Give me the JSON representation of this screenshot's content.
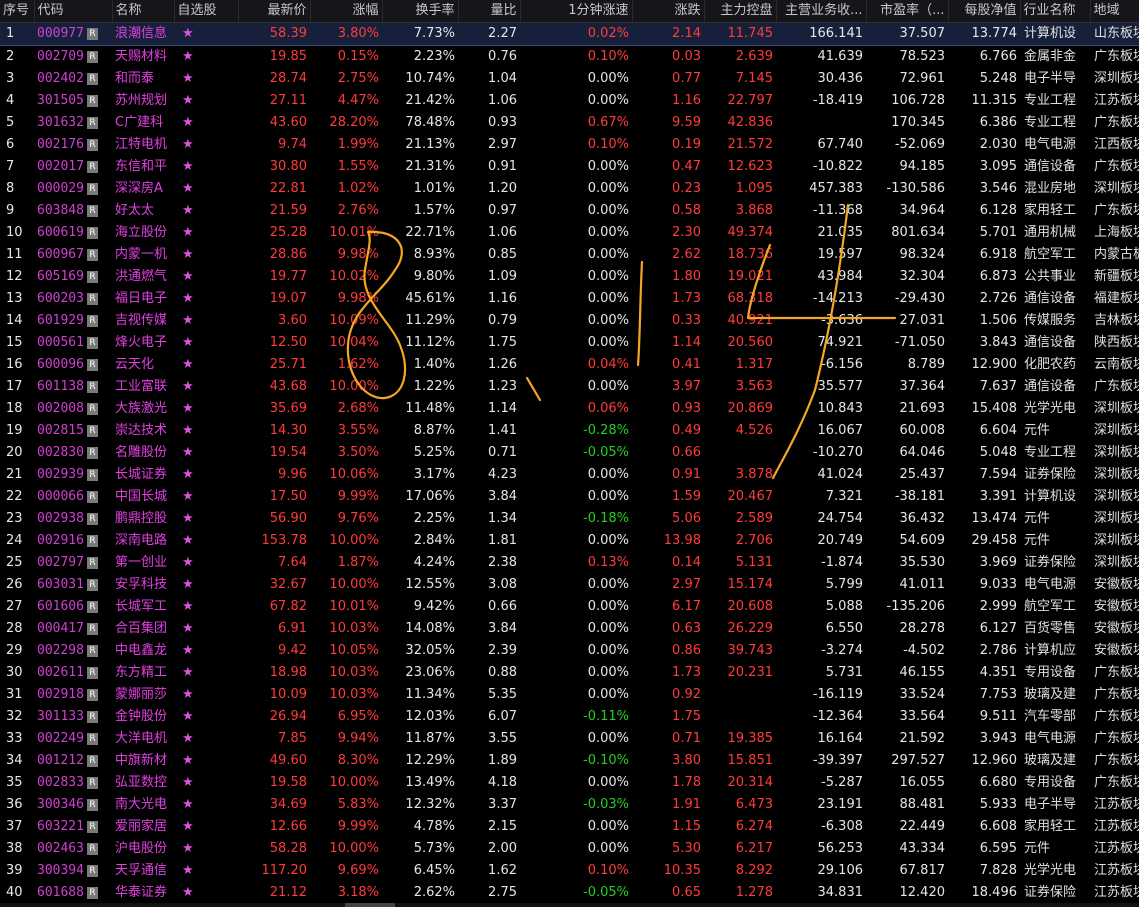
{
  "columns": {
    "seq": "序号",
    "code": "代码",
    "name": "名称",
    "fav": "自选股",
    "price": "最新价",
    "pct": "涨幅",
    "turnover": "换手率",
    "volratio": "量比",
    "speed": "1分钟涨速",
    "change": "涨跌",
    "mainctrl": "主力控盘",
    "bizgrowth": "主营业务收...",
    "pe": "市盈率（...",
    "navps": "每股净值",
    "industry": "行业名称",
    "region": "地域"
  },
  "r_badge": "R",
  "star_glyph": "★",
  "colors": {
    "up": "#ff3b3b",
    "down": "#22d022",
    "code": "#d040d0",
    "name": "#e040e0",
    "annotation": "#f5a623"
  },
  "rows": [
    {
      "seq": "1",
      "code": "000977",
      "name": "浪潮信息",
      "price": "58.39",
      "pct": "3.80%",
      "turnover": "7.73%",
      "volratio": "2.27",
      "speed": "0.02%",
      "change": "2.14",
      "mainctrl": "11.745",
      "biz": "166.141",
      "pe": "37.507",
      "navps": "13.774",
      "industry": "计算机设",
      "region": "山东板块",
      "speed_dir": "up",
      "biz_w": true
    },
    {
      "seq": "2",
      "code": "002709",
      "name": "天赐材料",
      "price": "19.85",
      "pct": "0.15%",
      "turnover": "2.23%",
      "volratio": "0.76",
      "speed": "0.10%",
      "change": "0.03",
      "mainctrl": "2.639",
      "biz": "41.639",
      "pe": "78.523",
      "navps": "6.766",
      "industry": "金属非金",
      "region": "广东板块",
      "speed_dir": "up"
    },
    {
      "seq": "3",
      "code": "002402",
      "name": "和而泰",
      "price": "28.74",
      "pct": "2.75%",
      "turnover": "10.74%",
      "volratio": "1.04",
      "speed": "0.00%",
      "change": "0.77",
      "mainctrl": "7.145",
      "biz": "30.436",
      "pe": "72.961",
      "navps": "5.248",
      "industry": "电子半导",
      "region": "深圳板块",
      "speed_dir": "flat"
    },
    {
      "seq": "4",
      "code": "301505",
      "name": "苏州规划",
      "price": "27.11",
      "pct": "4.47%",
      "turnover": "21.42%",
      "volratio": "1.06",
      "speed": "0.00%",
      "change": "1.16",
      "mainctrl": "22.797",
      "biz": "-18.419",
      "pe": "106.728",
      "navps": "11.315",
      "industry": "专业工程",
      "region": "江苏板块",
      "speed_dir": "flat"
    },
    {
      "seq": "5",
      "code": "301632",
      "name": "C广建科",
      "price": "43.60",
      "pct": "28.20%",
      "turnover": "78.48%",
      "volratio": "0.93",
      "speed": "0.67%",
      "change": "9.59",
      "mainctrl": "42.836",
      "biz": "",
      "pe": "170.345",
      "navps": "6.386",
      "industry": "专业工程",
      "region": "广东板块",
      "speed_dir": "up"
    },
    {
      "seq": "6",
      "code": "002176",
      "name": "江特电机",
      "price": "9.74",
      "pct": "1.99%",
      "turnover": "21.13%",
      "volratio": "2.97",
      "speed": "0.10%",
      "change": "0.19",
      "mainctrl": "21.572",
      "biz": "67.740",
      "pe": "-52.069",
      "navps": "2.030",
      "industry": "电气电源",
      "region": "江西板块",
      "speed_dir": "up"
    },
    {
      "seq": "7",
      "code": "002017",
      "name": "东信和平",
      "price": "30.80",
      "pct": "1.55%",
      "turnover": "21.31%",
      "volratio": "0.91",
      "speed": "0.00%",
      "change": "0.47",
      "mainctrl": "12.623",
      "biz": "-10.822",
      "pe": "94.185",
      "navps": "3.095",
      "industry": "通信设备",
      "region": "广东板块",
      "speed_dir": "flat"
    },
    {
      "seq": "8",
      "code": "000029",
      "name": "深深房A",
      "price": "22.81",
      "pct": "1.02%",
      "turnover": "1.01%",
      "volratio": "1.20",
      "speed": "0.00%",
      "change": "0.23",
      "mainctrl": "1.095",
      "biz": "457.383",
      "pe": "-130.586",
      "navps": "3.546",
      "industry": "混业房地",
      "region": "深圳板块",
      "speed_dir": "flat"
    },
    {
      "seq": "9",
      "code": "603848",
      "name": "好太太",
      "price": "21.59",
      "pct": "2.76%",
      "turnover": "1.57%",
      "volratio": "0.97",
      "speed": "0.00%",
      "change": "0.58",
      "mainctrl": "3.868",
      "biz": "-11.368",
      "pe": "34.964",
      "navps": "6.128",
      "industry": "家用轻工",
      "region": "广东板块",
      "speed_dir": "flat"
    },
    {
      "seq": "10",
      "code": "600619",
      "name": "海立股份",
      "price": "25.28",
      "pct": "10.01%",
      "turnover": "22.71%",
      "volratio": "1.06",
      "speed": "0.00%",
      "change": "2.30",
      "mainctrl": "49.374",
      "biz": "21.035",
      "pe": "801.634",
      "navps": "5.701",
      "industry": "通用机械",
      "region": "上海板块",
      "speed_dir": "flat"
    },
    {
      "seq": "11",
      "code": "600967",
      "name": "内蒙一机",
      "price": "28.86",
      "pct": "9.98%",
      "turnover": "8.93%",
      "volratio": "0.85",
      "speed": "0.00%",
      "change": "2.62",
      "mainctrl": "18.736",
      "biz": "19.597",
      "pe": "98.324",
      "navps": "6.918",
      "industry": "航空军工",
      "region": "内蒙古板",
      "speed_dir": "flat"
    },
    {
      "seq": "12",
      "code": "605169",
      "name": "洪通燃气",
      "price": "19.77",
      "pct": "10.02%",
      "turnover": "9.80%",
      "volratio": "1.09",
      "speed": "0.00%",
      "change": "1.80",
      "mainctrl": "19.021",
      "biz": "43.984",
      "pe": "32.304",
      "navps": "6.873",
      "industry": "公共事业",
      "region": "新疆板块",
      "speed_dir": "flat"
    },
    {
      "seq": "13",
      "code": "600203",
      "name": "福日电子",
      "price": "19.07",
      "pct": "9.98%",
      "turnover": "45.61%",
      "volratio": "1.16",
      "speed": "0.00%",
      "change": "1.73",
      "mainctrl": "68.318",
      "biz": "-14.213",
      "pe": "-29.430",
      "navps": "2.726",
      "industry": "通信设备",
      "region": "福建板块",
      "speed_dir": "flat"
    },
    {
      "seq": "14",
      "code": "601929",
      "name": "吉视传媒",
      "price": "3.60",
      "pct": "10.09%",
      "turnover": "11.29%",
      "volratio": "0.79",
      "speed": "0.00%",
      "change": "0.33",
      "mainctrl": "40.921",
      "biz": "-3.636",
      "pe": "27.031",
      "navps": "1.506",
      "industry": "传媒服务",
      "region": "吉林板块",
      "speed_dir": "flat"
    },
    {
      "seq": "15",
      "code": "000561",
      "name": "烽火电子",
      "price": "12.50",
      "pct": "10.04%",
      "turnover": "11.12%",
      "volratio": "1.75",
      "speed": "0.00%",
      "change": "1.14",
      "mainctrl": "20.560",
      "biz": "74.921",
      "pe": "-71.050",
      "navps": "3.843",
      "industry": "通信设备",
      "region": "陕西板块",
      "speed_dir": "flat"
    },
    {
      "seq": "16",
      "code": "600096",
      "name": "云天化",
      "price": "25.71",
      "pct": "1.62%",
      "turnover": "1.40%",
      "volratio": "1.26",
      "speed": "0.04%",
      "change": "0.41",
      "mainctrl": "1.317",
      "biz": "-6.156",
      "pe": "8.789",
      "navps": "12.900",
      "industry": "化肥农药",
      "region": "云南板块",
      "speed_dir": "up"
    },
    {
      "seq": "17",
      "code": "601138",
      "name": "工业富联",
      "price": "43.68",
      "pct": "10.00%",
      "turnover": "1.22%",
      "volratio": "1.23",
      "speed": "0.00%",
      "change": "3.97",
      "mainctrl": "3.563",
      "biz": "35.577",
      "pe": "37.364",
      "navps": "7.637",
      "industry": "通信设备",
      "region": "广东板块",
      "speed_dir": "flat"
    },
    {
      "seq": "18",
      "code": "002008",
      "name": "大族激光",
      "price": "35.69",
      "pct": "2.68%",
      "turnover": "11.48%",
      "volratio": "1.14",
      "speed": "0.06%",
      "change": "0.93",
      "mainctrl": "20.869",
      "biz": "10.843",
      "pe": "21.693",
      "navps": "15.408",
      "industry": "光学光电",
      "region": "深圳板块",
      "speed_dir": "up"
    },
    {
      "seq": "19",
      "code": "002815",
      "name": "崇达技术",
      "price": "14.30",
      "pct": "3.55%",
      "turnover": "8.87%",
      "volratio": "1.41",
      "speed": "-0.28%",
      "change": "0.49",
      "mainctrl": "4.526",
      "biz": "16.067",
      "pe": "60.008",
      "navps": "6.604",
      "industry": "元件",
      "region": "深圳板块",
      "speed_dir": "down"
    },
    {
      "seq": "20",
      "code": "002830",
      "name": "名雕股份",
      "price": "19.54",
      "pct": "3.50%",
      "turnover": "5.25%",
      "volratio": "0.71",
      "speed": "-0.05%",
      "change": "0.66",
      "mainctrl": "",
      "biz": "-10.270",
      "pe": "64.046",
      "navps": "5.048",
      "industry": "专业工程",
      "region": "深圳板块",
      "speed_dir": "down"
    },
    {
      "seq": "21",
      "code": "002939",
      "name": "长城证券",
      "price": "9.96",
      "pct": "10.06%",
      "turnover": "3.17%",
      "volratio": "4.23",
      "speed": "0.00%",
      "change": "0.91",
      "mainctrl": "3.878",
      "biz": "41.024",
      "pe": "25.437",
      "navps": "7.594",
      "industry": "证券保险",
      "region": "深圳板块",
      "speed_dir": "flat"
    },
    {
      "seq": "22",
      "code": "000066",
      "name": "中国长城",
      "price": "17.50",
      "pct": "9.99%",
      "turnover": "17.06%",
      "volratio": "3.84",
      "speed": "0.00%",
      "change": "1.59",
      "mainctrl": "20.467",
      "biz": "7.321",
      "pe": "-38.181",
      "navps": "3.391",
      "industry": "计算机设",
      "region": "深圳板块",
      "speed_dir": "flat"
    },
    {
      "seq": "23",
      "code": "002938",
      "name": "鹏鼎控股",
      "price": "56.90",
      "pct": "9.76%",
      "turnover": "2.25%",
      "volratio": "1.34",
      "speed": "-0.18%",
      "change": "5.06",
      "mainctrl": "2.589",
      "biz": "24.754",
      "pe": "36.432",
      "navps": "13.474",
      "industry": "元件",
      "region": "深圳板块",
      "speed_dir": "down"
    },
    {
      "seq": "24",
      "code": "002916",
      "name": "深南电路",
      "price": "153.78",
      "pct": "10.00%",
      "turnover": "2.84%",
      "volratio": "1.81",
      "speed": "0.00%",
      "change": "13.98",
      "mainctrl": "2.706",
      "biz": "20.749",
      "pe": "54.609",
      "navps": "29.458",
      "industry": "元件",
      "region": "深圳板块",
      "speed_dir": "flat"
    },
    {
      "seq": "25",
      "code": "002797",
      "name": "第一创业",
      "price": "7.64",
      "pct": "1.87%",
      "turnover": "4.24%",
      "volratio": "2.38",
      "speed": "0.13%",
      "change": "0.14",
      "mainctrl": "5.131",
      "biz": "-1.874",
      "pe": "35.530",
      "navps": "3.969",
      "industry": "证券保险",
      "region": "深圳板块",
      "speed_dir": "up"
    },
    {
      "seq": "26",
      "code": "603031",
      "name": "安孚科技",
      "price": "32.67",
      "pct": "10.00%",
      "turnover": "12.55%",
      "volratio": "3.08",
      "speed": "0.00%",
      "change": "2.97",
      "mainctrl": "15.174",
      "biz": "5.799",
      "pe": "41.011",
      "navps": "9.033",
      "industry": "电气电源",
      "region": "安徽板块",
      "speed_dir": "flat"
    },
    {
      "seq": "27",
      "code": "601606",
      "name": "长城军工",
      "price": "67.82",
      "pct": "10.01%",
      "turnover": "9.42%",
      "volratio": "0.66",
      "speed": "0.00%",
      "change": "6.17",
      "mainctrl": "20.608",
      "biz": "5.088",
      "pe": "-135.206",
      "navps": "2.999",
      "industry": "航空军工",
      "region": "安徽板块",
      "speed_dir": "flat"
    },
    {
      "seq": "28",
      "code": "000417",
      "name": "合百集团",
      "price": "6.91",
      "pct": "10.03%",
      "turnover": "14.08%",
      "volratio": "3.84",
      "speed": "0.00%",
      "change": "0.63",
      "mainctrl": "26.229",
      "biz": "6.550",
      "pe": "28.278",
      "navps": "6.127",
      "industry": "百货零售",
      "region": "安徽板块",
      "speed_dir": "flat"
    },
    {
      "seq": "29",
      "code": "002298",
      "name": "中电鑫龙",
      "price": "9.42",
      "pct": "10.05%",
      "turnover": "32.05%",
      "volratio": "2.39",
      "speed": "0.00%",
      "change": "0.86",
      "mainctrl": "39.743",
      "biz": "-3.274",
      "pe": "-4.502",
      "navps": "2.786",
      "industry": "计算机应",
      "region": "安徽板块",
      "speed_dir": "flat"
    },
    {
      "seq": "30",
      "code": "002611",
      "name": "东方精工",
      "price": "18.98",
      "pct": "10.03%",
      "turnover": "23.06%",
      "volratio": "0.88",
      "speed": "0.00%",
      "change": "1.73",
      "mainctrl": "20.231",
      "biz": "5.731",
      "pe": "46.155",
      "navps": "4.351",
      "industry": "专用设备",
      "region": "广东板块",
      "speed_dir": "flat"
    },
    {
      "seq": "31",
      "code": "002918",
      "name": "蒙娜丽莎",
      "price": "10.09",
      "pct": "10.03%",
      "turnover": "11.34%",
      "volratio": "5.35",
      "speed": "0.00%",
      "change": "0.92",
      "mainctrl": "",
      "biz": "-16.119",
      "pe": "33.524",
      "navps": "7.753",
      "industry": "玻璃及建",
      "region": "广东板块",
      "speed_dir": "flat"
    },
    {
      "seq": "32",
      "code": "301133",
      "name": "金钟股份",
      "price": "26.94",
      "pct": "6.95%",
      "turnover": "12.03%",
      "volratio": "6.07",
      "speed": "-0.11%",
      "change": "1.75",
      "mainctrl": "",
      "biz": "-12.364",
      "pe": "33.564",
      "navps": "9.511",
      "industry": "汽车零部",
      "region": "广东板块",
      "speed_dir": "down"
    },
    {
      "seq": "33",
      "code": "002249",
      "name": "大洋电机",
      "price": "7.85",
      "pct": "9.94%",
      "turnover": "11.87%",
      "volratio": "3.55",
      "speed": "0.00%",
      "change": "0.71",
      "mainctrl": "19.385",
      "biz": "16.164",
      "pe": "21.592",
      "navps": "3.943",
      "industry": "电气电源",
      "region": "广东板块",
      "speed_dir": "flat"
    },
    {
      "seq": "34",
      "code": "001212",
      "name": "中旗新材",
      "price": "49.60",
      "pct": "8.30%",
      "turnover": "12.29%",
      "volratio": "1.89",
      "speed": "-0.10%",
      "change": "3.80",
      "mainctrl": "15.851",
      "biz": "-39.397",
      "pe": "297.527",
      "navps": "12.960",
      "industry": "玻璃及建",
      "region": "广东板块",
      "speed_dir": "down"
    },
    {
      "seq": "35",
      "code": "002833",
      "name": "弘亚数控",
      "price": "19.58",
      "pct": "10.00%",
      "turnover": "13.49%",
      "volratio": "4.18",
      "speed": "0.00%",
      "change": "1.78",
      "mainctrl": "20.314",
      "biz": "-5.287",
      "pe": "16.055",
      "navps": "6.680",
      "industry": "专用设备",
      "region": "广东板块",
      "speed_dir": "flat"
    },
    {
      "seq": "36",
      "code": "300346",
      "name": "南大光电",
      "price": "34.69",
      "pct": "5.83%",
      "turnover": "12.32%",
      "volratio": "3.37",
      "speed": "-0.03%",
      "change": "1.91",
      "mainctrl": "6.473",
      "biz": "23.191",
      "pe": "88.481",
      "navps": "5.933",
      "industry": "电子半导",
      "region": "江苏板块",
      "speed_dir": "down"
    },
    {
      "seq": "37",
      "code": "603221",
      "name": "爱丽家居",
      "price": "12.66",
      "pct": "9.99%",
      "turnover": "4.78%",
      "volratio": "2.15",
      "speed": "0.00%",
      "change": "1.15",
      "mainctrl": "6.274",
      "biz": "-6.308",
      "pe": "22.449",
      "navps": "6.608",
      "industry": "家用轻工",
      "region": "江苏板块",
      "speed_dir": "flat"
    },
    {
      "seq": "38",
      "code": "002463",
      "name": "沪电股份",
      "price": "58.28",
      "pct": "10.00%",
      "turnover": "5.73%",
      "volratio": "2.00",
      "speed": "0.00%",
      "change": "5.30",
      "mainctrl": "6.217",
      "biz": "56.253",
      "pe": "43.334",
      "navps": "6.595",
      "industry": "元件",
      "region": "江苏板块",
      "speed_dir": "flat"
    },
    {
      "seq": "39",
      "code": "300394",
      "name": "天孚通信",
      "price": "117.20",
      "pct": "9.69%",
      "turnover": "6.45%",
      "volratio": "1.62",
      "speed": "0.10%",
      "change": "10.35",
      "mainctrl": "8.292",
      "biz": "29.106",
      "pe": "67.817",
      "navps": "7.828",
      "industry": "光学光电",
      "region": "江苏板块",
      "speed_dir": "up"
    },
    {
      "seq": "40",
      "code": "601688",
      "name": "华泰证券",
      "price": "21.12",
      "pct": "3.18%",
      "turnover": "2.62%",
      "volratio": "2.75",
      "speed": "-0.05%",
      "change": "0.65",
      "mainctrl": "1.278",
      "biz": "34.831",
      "pe": "12.420",
      "navps": "18.496",
      "industry": "证券保险",
      "region": "江苏板块",
      "speed_dir": "down"
    }
  ]
}
